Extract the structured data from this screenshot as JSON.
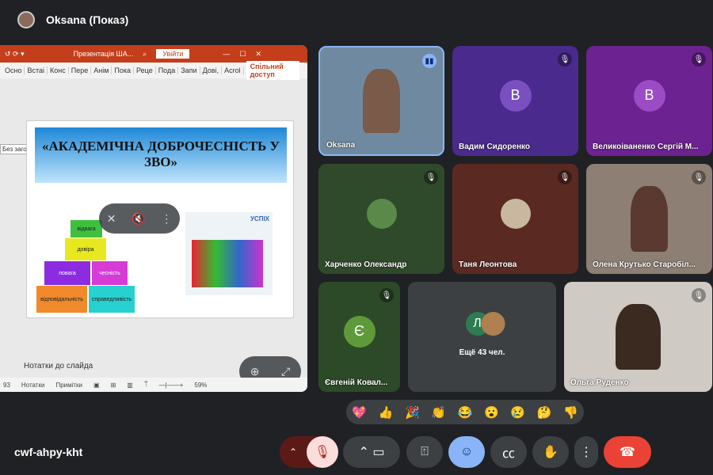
{
  "header": {
    "presenter": "Oksana (Показ)"
  },
  "ppt": {
    "doc_title": "Презентація ША...",
    "login": "Увійти",
    "tabs": [
      "Осно",
      "Встаі",
      "Конс",
      "Пере",
      "Анім",
      "Пока",
      "Реце",
      "Пода",
      "Запи",
      "Дові,",
      "Acrol"
    ],
    "share": "Спільний доступ",
    "tooltip": "Без заголовка",
    "slide_title": "«АКАДЕМІЧНА ДОБРОЧЕСНІСТЬ У ЗВО»",
    "blocks": [
      "відвага",
      "довіра",
      "повага",
      "чесність",
      "відповідальність",
      "справедливість"
    ],
    "success": "УСПІХ",
    "notes_placeholder": "Нотатки до слайда",
    "status": {
      "slide_num": "93",
      "notes": "Нотатки",
      "comments": "Примітки",
      "zoom": "59%"
    }
  },
  "tiles": [
    {
      "name": "Oksana",
      "bg": "#6f8aa0"
    },
    {
      "name": "Вадим Сидоренко",
      "letter": "В",
      "bg": "#4a2a8c",
      "lbg": "#7a4fc0"
    },
    {
      "name": "Великоіваненко Сергій М...",
      "letter": "В",
      "bg": "#6c2290",
      "lbg": "#9b4cc4"
    },
    {
      "name": "Харченко Олександр",
      "bg": "#2f4a2a"
    },
    {
      "name": "Таня Леонтова",
      "bg": "#5a2a22"
    },
    {
      "name": "Олена Крутько Старобіл...",
      "bg": "#8d7f74"
    },
    {
      "name": "Євгеній Ковал...",
      "letter": "Є",
      "bg": "#2d4a28",
      "lbg": "#5e9a3a"
    },
    {
      "more": "Ещё 43 чел.",
      "letter": "Л",
      "bg": "#3c4043"
    },
    {
      "name": "Ольга Руденко",
      "bg": "#cfcac4"
    }
  ],
  "reactions": [
    "💖",
    "👍",
    "🎉",
    "👏",
    "😂",
    "😮",
    "😢",
    "🤔",
    "👎"
  ],
  "meeting_code": "cwf-ahpy-kht",
  "colors": {
    "end_call": "#ea4335",
    "mic_off": "#f9dedc",
    "accent": "#8ab4f8"
  }
}
